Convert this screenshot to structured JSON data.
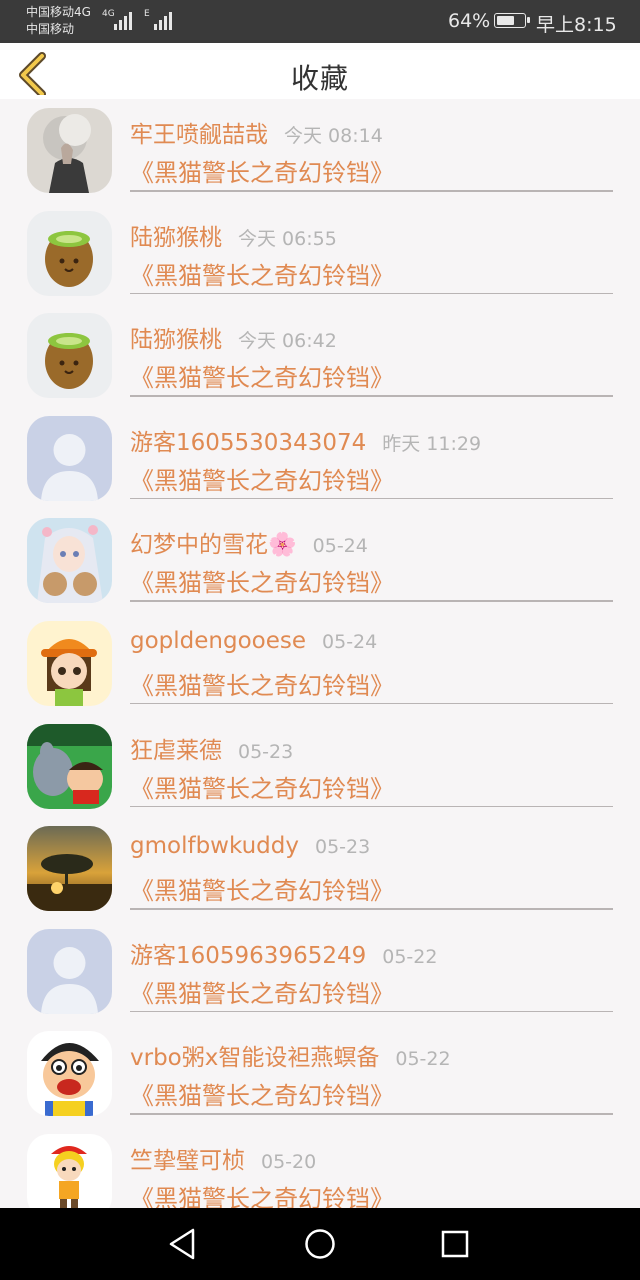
{
  "status_bar": {
    "carrier1": "中国移动4G",
    "carrier2": "中国移动",
    "sig1_tag": "4G",
    "sig2_tag": "E",
    "battery_percent": "64%",
    "battery_level": 0.64,
    "clock": "早上8:15"
  },
  "header": {
    "title": "收藏",
    "back_icon": "chevron-left-icon",
    "accent_color": "#e08a52"
  },
  "favorites": [
    {
      "name": "牢王喷觎喆哉",
      "time": "今天 08:14",
      "book": "《黑猫警长之奇幻铃铛》",
      "avatar": "smoke-portrait"
    },
    {
      "name": "陆猕猴桃",
      "time": "今天 06:55",
      "book": "《黑猫警长之奇幻铃铛》",
      "avatar": "kiwi"
    },
    {
      "name": "陆猕猴桃",
      "time": "今天 06:42",
      "book": "《黑猫警长之奇幻铃铛》",
      "avatar": "kiwi"
    },
    {
      "name": "游客1605530343074",
      "time": "昨天 11:29",
      "book": "《黑猫警长之奇幻铃铛》",
      "avatar": "default-user"
    },
    {
      "name": "幻梦中的雪花🌸",
      "time": "05-24",
      "book": "《黑猫警长之奇幻铃铛》",
      "avatar": "anime-girl"
    },
    {
      "name": "gopldengooese",
      "time": "05-24",
      "book": "《黑猫警长之奇幻铃铛》",
      "avatar": "cartoon-girl-hat"
    },
    {
      "name": "狂虐莱德",
      "time": "05-23",
      "book": "《黑猫警长之奇幻铃铛》",
      "avatar": "cartoon-scene"
    },
    {
      "name": "gmolfbwkuddy",
      "time": "05-23",
      "book": "《黑猫警长之奇幻铃铛》",
      "avatar": "sunset-tree"
    },
    {
      "name": "游客1605963965249",
      "time": "05-22",
      "book": "《黑猫警长之奇幻铃铛》",
      "avatar": "default-user"
    },
    {
      "name": "vrbo粥x智能设袒燕螟备",
      "time": "05-22",
      "book": "《黑猫警长之奇幻铃铛》",
      "avatar": "funny-face"
    },
    {
      "name": "竺挚璧可桢",
      "time": "05-20",
      "book": "《黑猫警长之奇幻铃铛》",
      "avatar": "cartoon-boy"
    }
  ],
  "nav_bar": {
    "back": "triangle-back-icon",
    "home": "circle-home-icon",
    "recents": "square-recents-icon"
  }
}
